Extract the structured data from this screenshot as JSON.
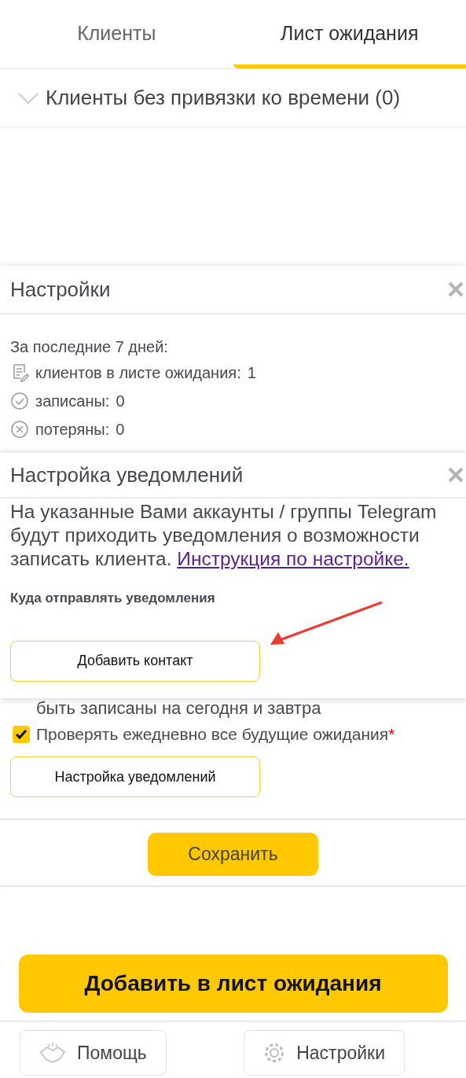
{
  "tabs": [
    {
      "label": "Клиенты",
      "selected": false
    },
    {
      "label": "Лист ожидания",
      "selected": true
    }
  ],
  "group": {
    "title": "Клиенты без привязки ко времени (0)",
    "expanded": false
  },
  "settings_panel": {
    "title": "Настройки",
    "period": "За последние 7 дней:",
    "stats": [
      {
        "kind": "list",
        "label": "клиентов в листе ожидания:",
        "value": "1"
      },
      {
        "kind": "done",
        "label": "записаны:",
        "value": "0"
      },
      {
        "kind": "lost",
        "label": "потеряны:",
        "value": "0"
      }
    ],
    "partial_text": "быть записаны на сегодня и завтра",
    "checkbox": {
      "label": "Проверять ежедневно все будущие ожидания",
      "required_mark": "*",
      "checked": true
    },
    "notify_button": "Настройка уведомлений",
    "save_button": "Сохранить"
  },
  "notification_dialog": {
    "title": "Настройка уведомлений",
    "description": "На указанные Вами аккаунты / группы Telegram будут приходить уведомления о возможности записать клиента.",
    "link": "Инструкция по настройке.",
    "section_label": "Куда отправлять уведомления",
    "add_contact_button": "Добавить контакт"
  },
  "add_button": "Добавить в лист ожидания",
  "footer_buttons": [
    {
      "kind": "help",
      "label": "Помощь"
    },
    {
      "kind": "settings",
      "label": "Настройки"
    }
  ]
}
